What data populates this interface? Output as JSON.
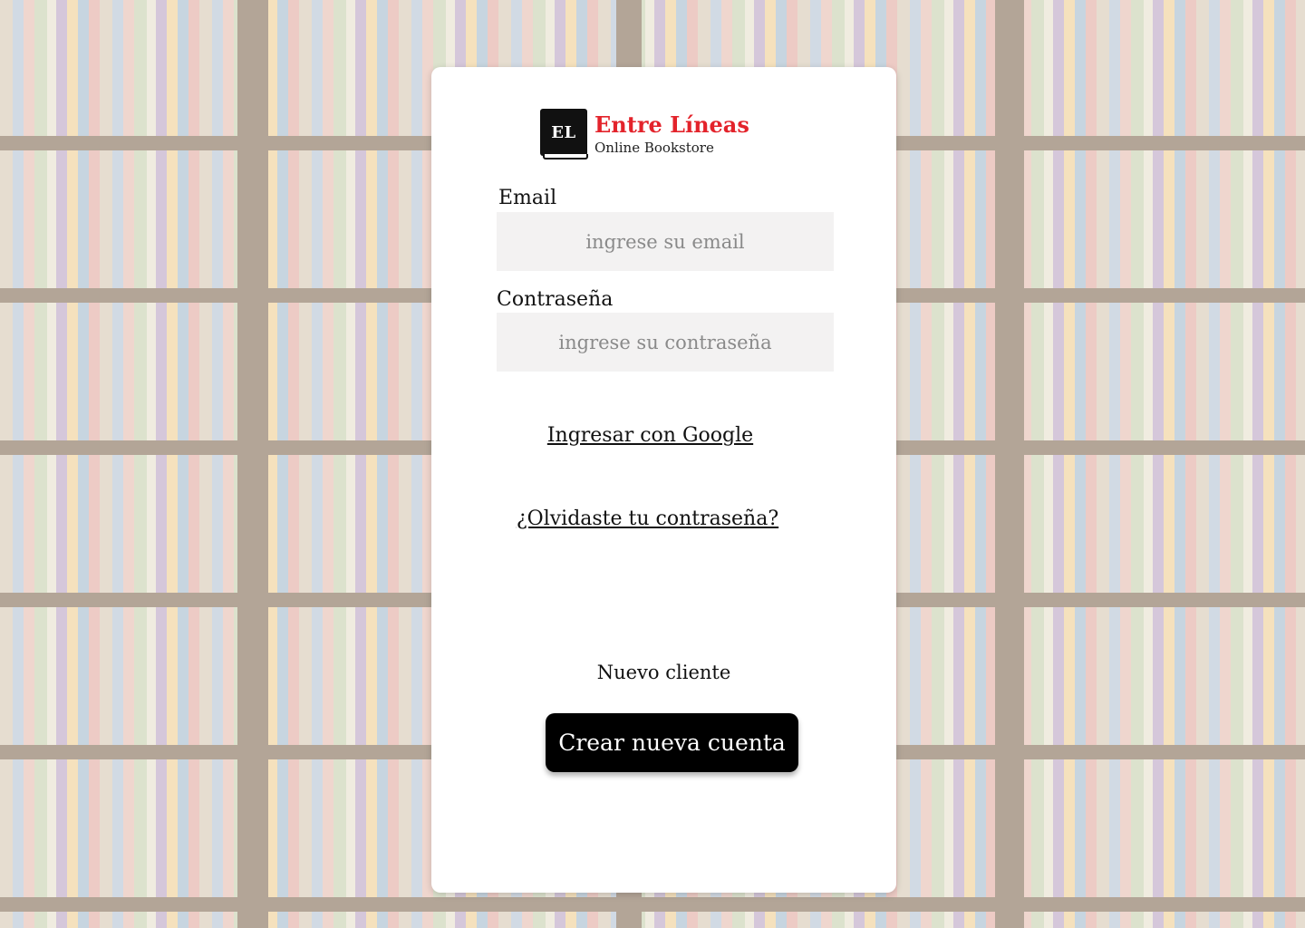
{
  "brand": {
    "logo_initials": "EL",
    "name": "Entre Líneas",
    "tagline": "Online Bookstore",
    "accent_color": "#e3232b"
  },
  "login": {
    "email_label": "Email",
    "email_placeholder": "ingrese su email",
    "email_value": "",
    "password_label": "Contraseña",
    "password_placeholder": "ingrese su contraseña",
    "password_value": "",
    "google_link": "Ingresar con Google",
    "forgot_link": "¿Olvidaste tu contraseña?"
  },
  "signup": {
    "prompt": "Nuevo cliente",
    "button_label": "Crear nueva cuenta"
  },
  "background": {
    "image_subject": "bookstore-shelves"
  }
}
